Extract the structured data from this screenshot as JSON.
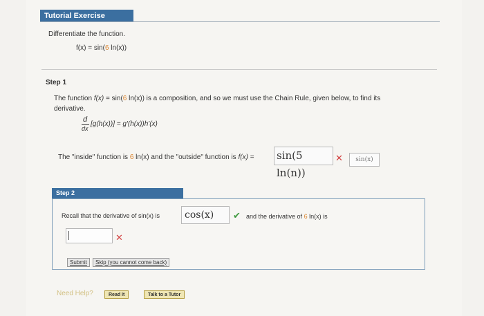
{
  "header": {
    "title": "Tutorial Exercise"
  },
  "intro": {
    "instruction": "Differentiate the function.",
    "function_lhs": "f(x) = sin(",
    "function_coef": "6",
    "function_rhs": " ln(x))"
  },
  "step1": {
    "label": "Step 1",
    "text_a": "The function ",
    "text_fx": "f(x)",
    "text_b": " = sin(",
    "text_coef": "6",
    "text_c": " ln(x)) is a composition, and so we must use the Chain Rule, given below, to find its",
    "text_line2": "derivative.",
    "chain_d": "d",
    "chain_dx": "dx",
    "chain_rule": "[g(h(x))] = g'(h(x))h'(x)",
    "inside_a": "The \"inside\" function is ",
    "inside_coef": "6",
    "inside_b": " ln(x) and the \"outside\" function is ",
    "inside_fx": "f(x)",
    "inside_eq": " =",
    "answer_value": "sin(5 ln(n))",
    "answer_mark": "✕",
    "correct_hint": "sin(x)"
  },
  "step2": {
    "tab_label": "Step 2",
    "recall_text": "Recall that the derivative of sin(x) is",
    "answer_value": "cos(x)",
    "answer_mark": "✔",
    "and_text_a": "and the derivative of ",
    "and_coef": "6",
    "and_text_b": " ln(x) is",
    "empty_mark": "✕",
    "submit_label": "Submit",
    "skip_label": "Skip (you cannot come back)"
  },
  "help": {
    "label": "Need Help?",
    "read_label": "Read It",
    "talk_label": "Talk to a Tutor"
  },
  "colors": {
    "accent": "#3b6fa0",
    "coef": "#d9822b",
    "wrong": "#d34242",
    "right": "#3f9a3f"
  }
}
